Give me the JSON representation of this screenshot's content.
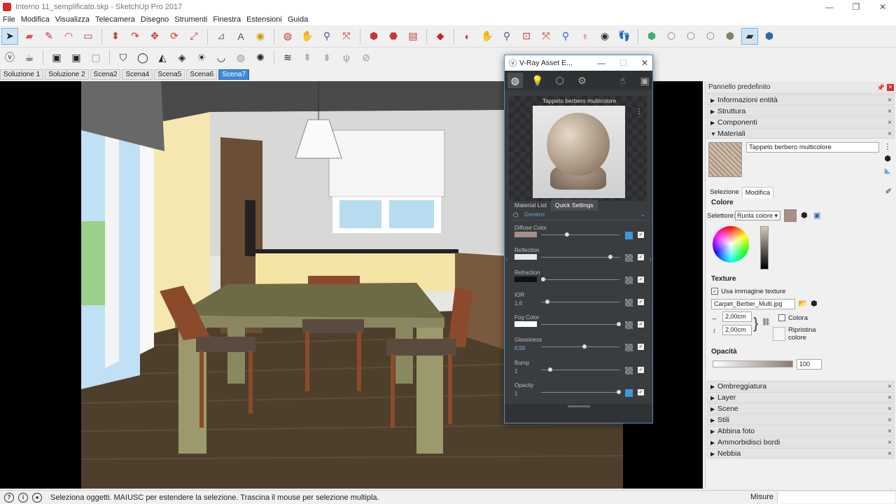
{
  "window": {
    "title": "Interno 11_semplificato.skp - SketchUp Pro 2017",
    "minimize": "—",
    "maximize": "❐",
    "close": "✕"
  },
  "menu": [
    "File",
    "Modifica",
    "Visualizza",
    "Telecamera",
    "Disegno",
    "Strumenti",
    "Finestra",
    "Estensioni",
    "Guida"
  ],
  "scene_tabs": [
    {
      "label": "Soluzione 1",
      "active": false
    },
    {
      "label": "Soluzione 2",
      "active": false
    },
    {
      "label": "Scena2",
      "active": false
    },
    {
      "label": "Scena4",
      "active": false
    },
    {
      "label": "Scena5",
      "active": false
    },
    {
      "label": "Scena6",
      "active": false
    },
    {
      "label": "Scena7",
      "active": true
    }
  ],
  "colors": {
    "accent": "#3b8ad8",
    "close_red": "#d62a2a",
    "vray_bg": "#3a3d40",
    "vray_highlight": "#3a9ad9"
  },
  "vray": {
    "title": "V-Ray Asset E...",
    "material_name": "Tappeto berbero multicolore",
    "tabs": [
      "Material List",
      "Quick Settings"
    ],
    "active_tab": "Quick Settings",
    "type": "Generic",
    "params": [
      {
        "name": "Diffuse Color",
        "swatch": "#a58f88",
        "knob": 0.33,
        "map_on": true
      },
      {
        "name": "Reflection",
        "swatch": "#e8e8e8",
        "knob": 0.88,
        "map_on": false
      },
      {
        "name": "Refraction",
        "swatch": "#111111",
        "knob": 0.03,
        "map_on": false
      },
      {
        "name": "IOR",
        "value": "1,6",
        "knob": 0.08,
        "map_on": false
      },
      {
        "name": "Fog Color",
        "swatch": "#ffffff",
        "knob": 0.99,
        "map_on": false
      },
      {
        "name": "Glossiness",
        "value": "0,55",
        "knob": 0.55,
        "map_on": false
      },
      {
        "name": "Bump",
        "value": "1",
        "knob": 0.12,
        "map_on": false
      },
      {
        "name": "Opacity",
        "value": "1",
        "knob": 0.99,
        "map_on": true
      }
    ]
  },
  "tray": {
    "title": "Pannello predefinito",
    "sections_top": [
      "Informazioni entità",
      "Struttura",
      "Componenti",
      "Materiali"
    ],
    "sections_bottom": [
      "Ombreggiatura",
      "Layer",
      "Scene",
      "Stili",
      "Abbina foto",
      "Ammorbidisci bordi",
      "Nebbia"
    ],
    "materials": {
      "name": "Tappeto berbero multicolore",
      "tab_select": "Selezione",
      "tab_edit": "Modifica",
      "color_label": "Colore",
      "selector_label": "Selettore:",
      "selector_value": "Ruota colore",
      "texture_label": "Texture",
      "use_texture": "Usa immagine texture",
      "texture_file": "Carpet_Berber_Multi.jpg",
      "width": "2,00cm",
      "height": "2,00cm",
      "colorize": "Colora",
      "reset_color": "Ripristina colore",
      "opacity_label": "Opacità",
      "opacity_value": "100"
    }
  },
  "status": {
    "message": "Seleziona oggetti. MAIUSC per estendere la selezione. Trascina il mouse per selezione multipla.",
    "measure_label": "Misure"
  }
}
